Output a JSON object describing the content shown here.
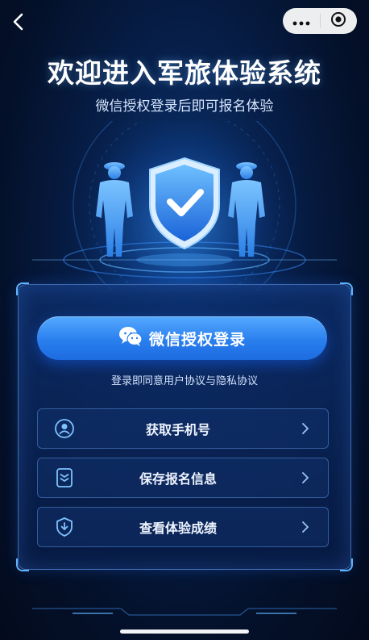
{
  "topbar": {
    "back_icon": "chevron-left-icon",
    "menu_icon": "more-dots-icon",
    "close_icon": "target-circle-icon"
  },
  "header": {
    "title": "欢迎进入军旅体验系统",
    "subtitle": "微信授权登录后即可报名体验"
  },
  "hero": {
    "icons": [
      "soldier-silhouette-icon",
      "shield-check-icon",
      "soldier-silhouette-icon"
    ]
  },
  "login": {
    "button_label": "微信授权登录",
    "button_icon": "wechat-icon",
    "agreement_text": "登录即同意用户协议与隐私协议"
  },
  "actions": [
    {
      "label": "获取手机号",
      "icon": "phone-badge-icon"
    },
    {
      "label": "保存报名信息",
      "icon": "form-save-icon"
    },
    {
      "label": "查看体验成绩",
      "icon": "score-badge-icon"
    }
  ],
  "colors": {
    "background": "#041230",
    "accent": "#2a7fee",
    "card_border": "#5fb3ff"
  }
}
